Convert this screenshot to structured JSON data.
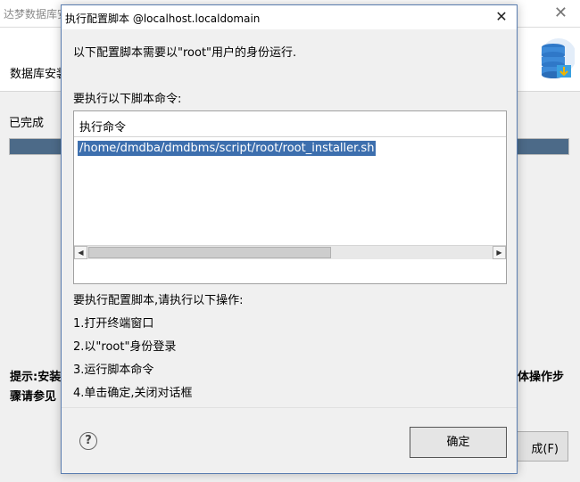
{
  "background_window": {
    "title": "达梦数据库安",
    "subtitle": "数据库安装",
    "status": "已完成",
    "progress": 1.0,
    "note_left_1": "提示:安装",
    "note_left_2": "骤请参见",
    "note_right": "体操作步",
    "button_label": "成(F)"
  },
  "dialog": {
    "title": "执行配置脚本 @localhost.localdomain",
    "intro": "以下配置脚本需要以\"root\"用户的身份运行.",
    "section_label": "要执行以下脚本命令:",
    "table_header": "执行命令",
    "commands": [
      "/home/dmdba/dmdbms/script/root/root_installer.sh"
    ],
    "instructions_title": "要执行配置脚本,请执行以下操作:",
    "steps": [
      "1.打开终端窗口",
      "2.以\"root\"身份登录",
      "3.运行脚本命令",
      "4.单击确定,关闭对话框"
    ],
    "ok_label": "确定",
    "help_icon": "question-circle-icon",
    "close_icon": "close-icon"
  },
  "colors": {
    "selection": "#3d6fae",
    "progress": "#4c6a88",
    "dialog_border": "#5a7db0"
  }
}
